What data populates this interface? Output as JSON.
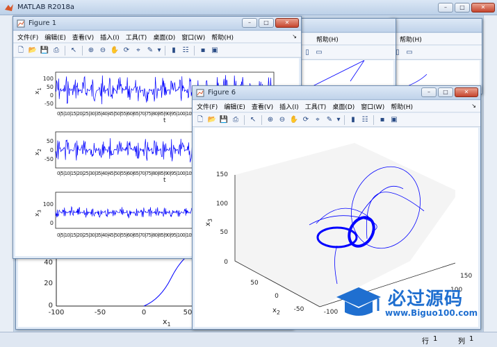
{
  "main_window": {
    "title": "MATLAB R2018a",
    "status": {
      "row_label": "行",
      "row_value": "1",
      "col_label": "列",
      "col_value": "1"
    }
  },
  "menu": [
    "文件(F)",
    "编辑(E)",
    "查看(V)",
    "插入(I)",
    "工具(T)",
    "桌面(D)",
    "窗口(W)",
    "帮助(H)"
  ],
  "background_windows": {
    "help_label": "帮助(H)"
  },
  "figure1": {
    "title": "Figure 1",
    "subplots": [
      {
        "ylabel": "x",
        "ysub": "1",
        "yticks": [
          "100",
          "50",
          "0",
          "-50"
        ],
        "xlabel": "t"
      },
      {
        "ylabel": "x",
        "ysub": "2",
        "yticks": [
          "50",
          "0",
          "-50"
        ],
        "xlabel": "t"
      },
      {
        "ylabel": "x",
        "ysub": "3",
        "yticks": [
          "100",
          "0"
        ],
        "xlabel": ""
      }
    ],
    "xtick_row": "0|5|10|15|20|25|30|35|40|45|50|55|60|65|70|75|80|85|90|95|100|105|110|115|120|125|130|135|140|145|150"
  },
  "figure_bg": {
    "yticks": [
      "40",
      "20",
      "0"
    ],
    "xticks": [
      "-100",
      "-50",
      "0",
      "50"
    ],
    "xlabel": "x",
    "xsub": "1"
  },
  "figure6": {
    "title": "Figure 6",
    "z_ticks": [
      "150",
      "100",
      "50",
      "0"
    ],
    "z_label": "x",
    "z_sub": "3",
    "x_ticks": [
      "50",
      "0",
      "-50",
      "-100"
    ],
    "x_label": "x",
    "x_sub": "2",
    "y_ticks": [
      "150",
      "100"
    ]
  },
  "watermark": {
    "text": "必过源码",
    "url": "www.Biguo100.com"
  },
  "colors": {
    "plot_line": "#0000ff",
    "title_bg": "#c0d3ea",
    "accent": "#2a6cc7"
  }
}
